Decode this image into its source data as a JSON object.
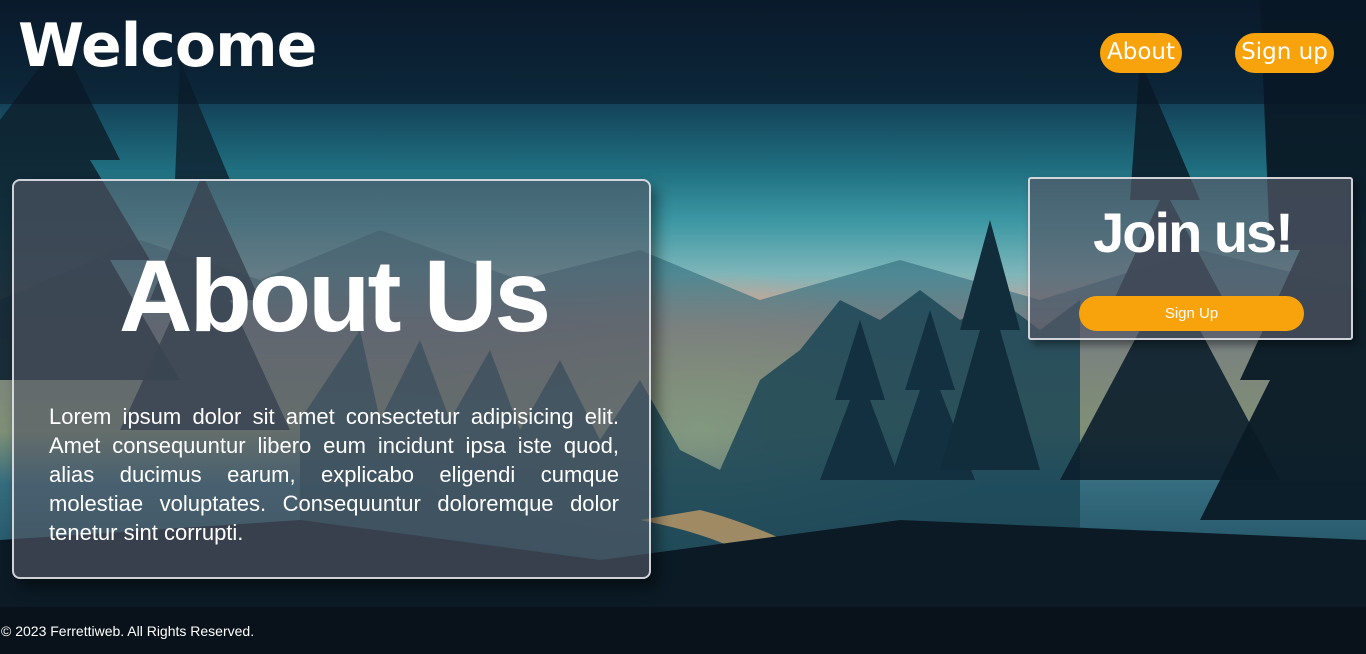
{
  "header": {
    "brand": "Welcome",
    "nav": [
      {
        "label": "About"
      },
      {
        "label": "Sign up"
      }
    ]
  },
  "about": {
    "title": "About Us",
    "body": "Lorem ipsum dolor sit amet consectetur adipisicing elit. Amet consequuntur libero eum incidunt ipsa iste quod, alias ducimus earum, explicabo eligendi cumque molestiae voluptates. Consequuntur doloremque dolor tenetur sint corrupti."
  },
  "join": {
    "title": "Join us!",
    "button_label": "Sign Up"
  },
  "footer": {
    "text": "© 2023 Ferrettiweb. All Rights Reserved."
  },
  "colors": {
    "accent": "#f8a30c",
    "card_bg": "#545866",
    "header_bg": "#081624",
    "text": "#ffffff"
  },
  "background": {
    "description_icon": "forest-landscape-image"
  }
}
